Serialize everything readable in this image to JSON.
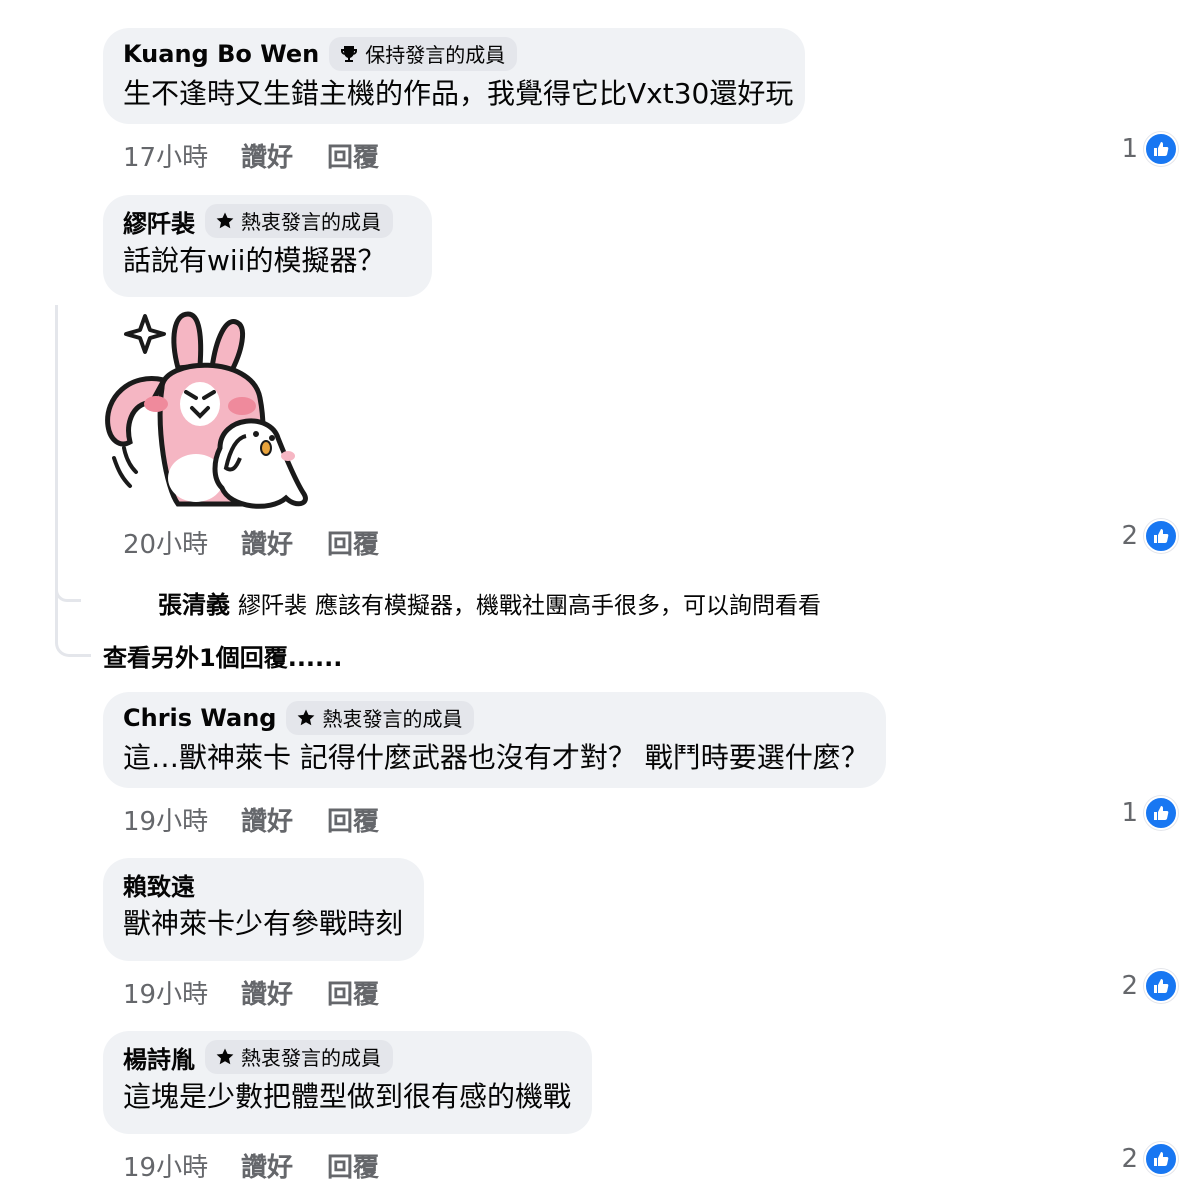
{
  "actions": {
    "like": "讚好",
    "reply": "回覆"
  },
  "comments": [
    {
      "author": "Kuang Bo Wen",
      "badge": "保持發言的成員",
      "badge_icon": "trophy-icon",
      "text": "生不逢時又生錯主機的作品，我覺得它比Vxt30還好玩",
      "time": "17小時",
      "reactions": "1"
    },
    {
      "author": "繆阡裴",
      "badge": "熱衷發言的成員",
      "badge_icon": "star-icon",
      "text": "話說有wii的模擬器？",
      "time": "20小時",
      "reactions": "2",
      "sticker": "rabbit-saluting-sticker",
      "nested_reply": {
        "author": "張清義",
        "mention": "繆阡裴",
        "text": "應該有模擬器，機戰社團高手很多，可以詢問看看"
      },
      "more_replies": "查看另外1個回覆......"
    },
    {
      "author": "Chris Wang",
      "badge": "熱衷發言的成員",
      "badge_icon": "star-icon",
      "text": "這…獸神萊卡 記得什麼武器也沒有才對？ 戰鬥時要選什麼？",
      "time": "19小時",
      "reactions": "1"
    },
    {
      "author": "賴致遠",
      "badge": "",
      "text": "獸神萊卡少有參戰時刻",
      "time": "19小時",
      "reactions": "2"
    },
    {
      "author": "楊詩胤",
      "badge": "熱衷發言的成員",
      "badge_icon": "star-icon",
      "text": "這塊是少數把體型做到很有感的機戰",
      "time": "19小時",
      "reactions": "2"
    }
  ],
  "colors": {
    "like_blue": "#1877f2",
    "bubble": "#f0f2f5",
    "meta": "#65676b"
  }
}
